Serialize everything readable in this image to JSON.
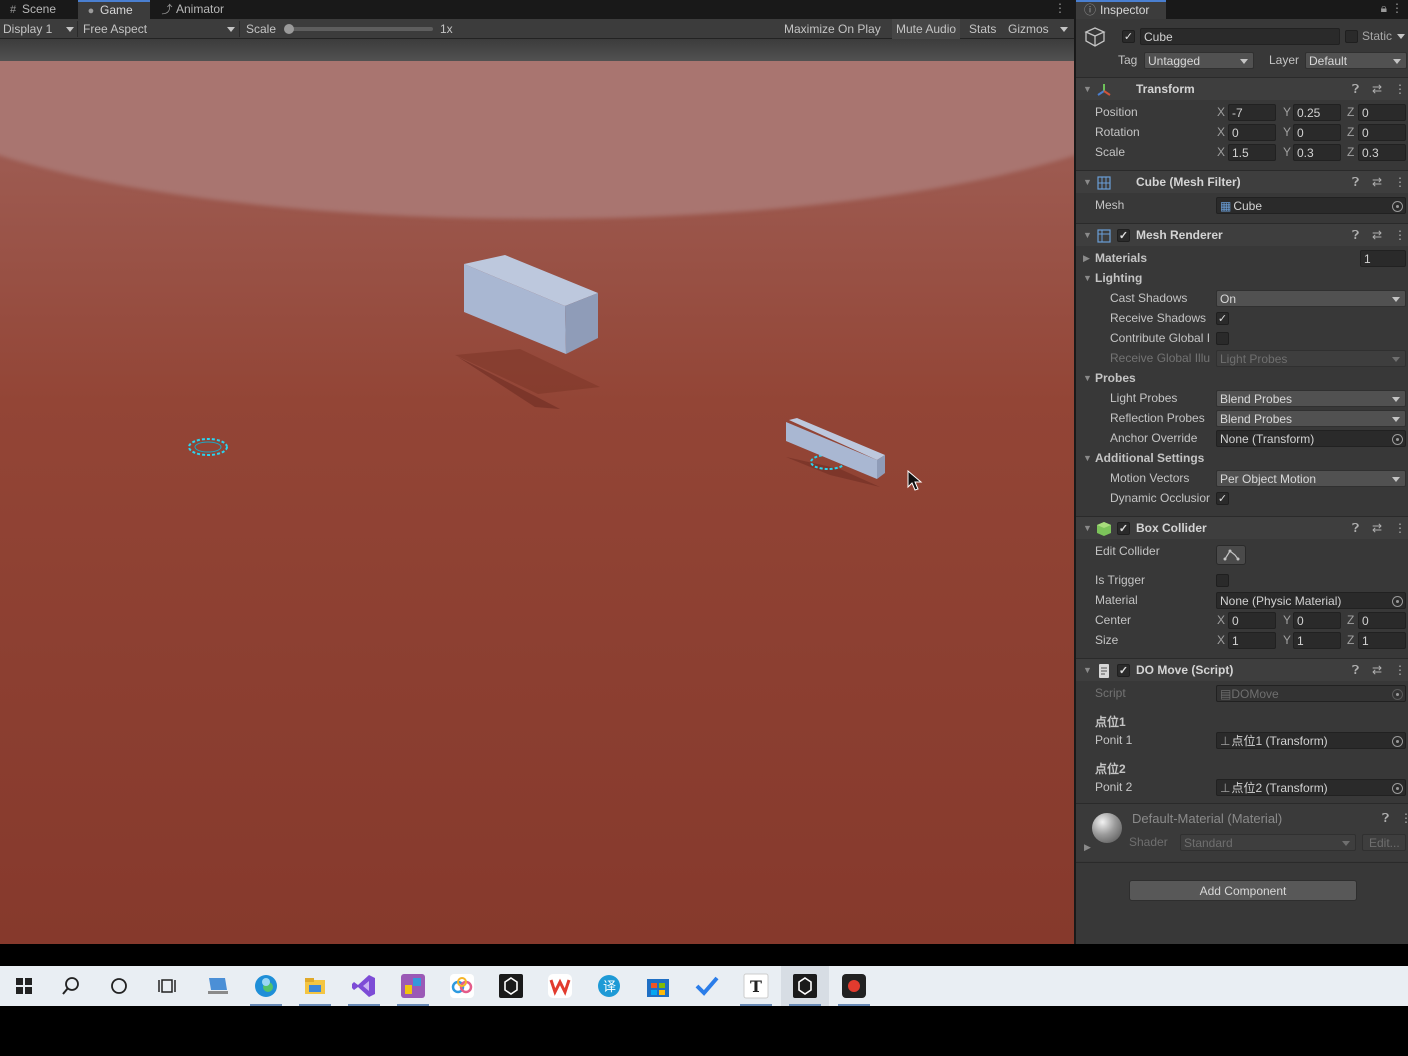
{
  "tabs": {
    "scene": "Scene",
    "game": "Game",
    "animator": "Animator"
  },
  "game_toolbar": {
    "display": "Display 1",
    "aspect": "Free Aspect",
    "scale_label": "Scale",
    "scale_value": "1x",
    "maximize": "Maximize On Play",
    "mute": "Mute Audio",
    "stats": "Stats",
    "gizmos": "Gizmos"
  },
  "inspector": {
    "tab": "Inspector",
    "object_name": "Cube",
    "static_label": "Static",
    "tag_label": "Tag",
    "tag_value": "Untagged",
    "layer_label": "Layer",
    "layer_value": "Default",
    "transform": {
      "title": "Transform",
      "position_label": "Position",
      "rotation_label": "Rotation",
      "scale_label": "Scale",
      "position": {
        "x": "-7",
        "y": "0.25",
        "z": "0"
      },
      "rotation": {
        "x": "0",
        "y": "0",
        "z": "0"
      },
      "scale": {
        "x": "1.5",
        "y": "0.3",
        "z": "0.3"
      }
    },
    "mesh_filter": {
      "title": "Cube (Mesh Filter)",
      "mesh_label": "Mesh",
      "mesh_value": "Cube"
    },
    "mesh_renderer": {
      "title": "Mesh Renderer",
      "materials_label": "Materials",
      "materials_count": "1",
      "lighting_label": "Lighting",
      "cast_shadows_label": "Cast Shadows",
      "cast_shadows_value": "On",
      "receive_shadows_label": "Receive Shadows",
      "contribute_gi_label": "Contribute Global I",
      "receive_gi_label": "Receive Global Illu",
      "receive_gi_value": "Light Probes",
      "probes_label": "Probes",
      "light_probes_label": "Light Probes",
      "light_probes_value": "Blend Probes",
      "reflection_probes_label": "Reflection Probes",
      "reflection_probes_value": "Blend Probes",
      "anchor_override_label": "Anchor Override",
      "anchor_override_value": "None (Transform)",
      "additional_label": "Additional Settings",
      "motion_vectors_label": "Motion Vectors",
      "motion_vectors_value": "Per Object Motion",
      "dynamic_occlusion_label": "Dynamic Occlusior"
    },
    "box_collider": {
      "title": "Box Collider",
      "edit_label": "Edit Collider",
      "trigger_label": "Is Trigger",
      "material_label": "Material",
      "material_value": "None (Physic Material)",
      "center_label": "Center",
      "size_label": "Size",
      "center": {
        "x": "0",
        "y": "0",
        "z": "0"
      },
      "size": {
        "x": "1",
        "y": "1",
        "z": "1"
      }
    },
    "do_move": {
      "title": "DO Move (Script)",
      "script_label": "Script",
      "script_value": "DOMove",
      "header1": "点位1",
      "ponit1_label": "Ponit 1",
      "ponit1_value": "点位1 (Transform)",
      "header2": "点位2",
      "ponit2_label": "Ponit 2",
      "ponit2_value": "点位2 (Transform)"
    },
    "material": {
      "title": "Default-Material (Material)",
      "shader_label": "Shader",
      "shader_value": "Standard",
      "edit_label": "Edit..."
    },
    "add_component": "Add Component"
  },
  "axis": {
    "x": "X",
    "y": "Y",
    "z": "Z"
  },
  "colors": {
    "ground": "#8c3f31",
    "cube": "#a9b7d2",
    "gizmo": "#2ad4f0",
    "accent": "#4a7fd0"
  },
  "taskbar_icons": [
    "windows-start",
    "search",
    "cortana",
    "task-view",
    "pc",
    "edge",
    "file-explorer",
    "visual-studio",
    "app-purple",
    "baidu-netdisk",
    "unity-hub",
    "wps",
    "translator",
    "store",
    "todo",
    "typora",
    "unity-editor",
    "recorder"
  ]
}
